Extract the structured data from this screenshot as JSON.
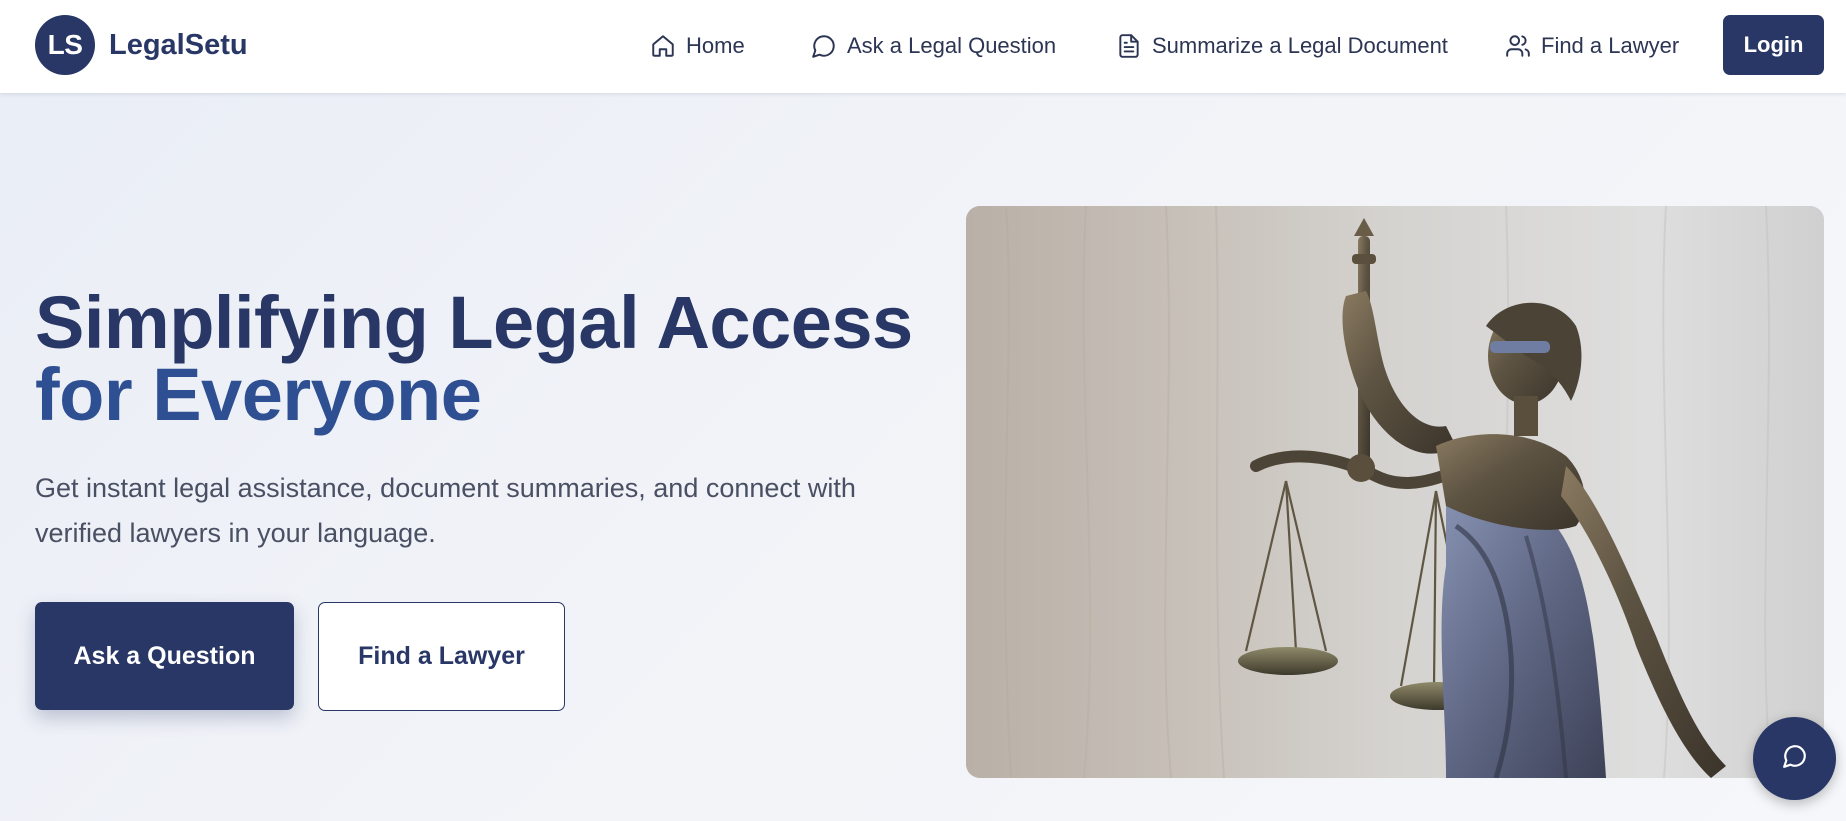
{
  "brand": {
    "logo_initials": "LS",
    "name": "LegalSetu"
  },
  "nav": {
    "items": [
      {
        "label": "Home",
        "icon": "home-icon"
      },
      {
        "label": "Ask a Legal Question",
        "icon": "chat-bubble-icon"
      },
      {
        "label": "Summarize a Legal Document",
        "icon": "document-icon"
      },
      {
        "label": "Find a Lawyer",
        "icon": "users-icon"
      }
    ],
    "login_label": "Login"
  },
  "hero": {
    "title_line1": "Simplifying Legal Access",
    "title_line2": "for Everyone",
    "subtitle": "Get instant legal assistance, document summaries, and connect with verified lawyers in your language.",
    "primary_button": "Ask a Question",
    "secondary_button": "Find a Lawyer",
    "image_subject": "lady-justice-statue"
  },
  "chat_fab": {
    "icon": "chat-bubble-icon"
  },
  "colors": {
    "primary": "#283766",
    "accent_blue": "#2f4f93",
    "header_bg": "#ffffff",
    "page_bg": "#eef1f6"
  }
}
